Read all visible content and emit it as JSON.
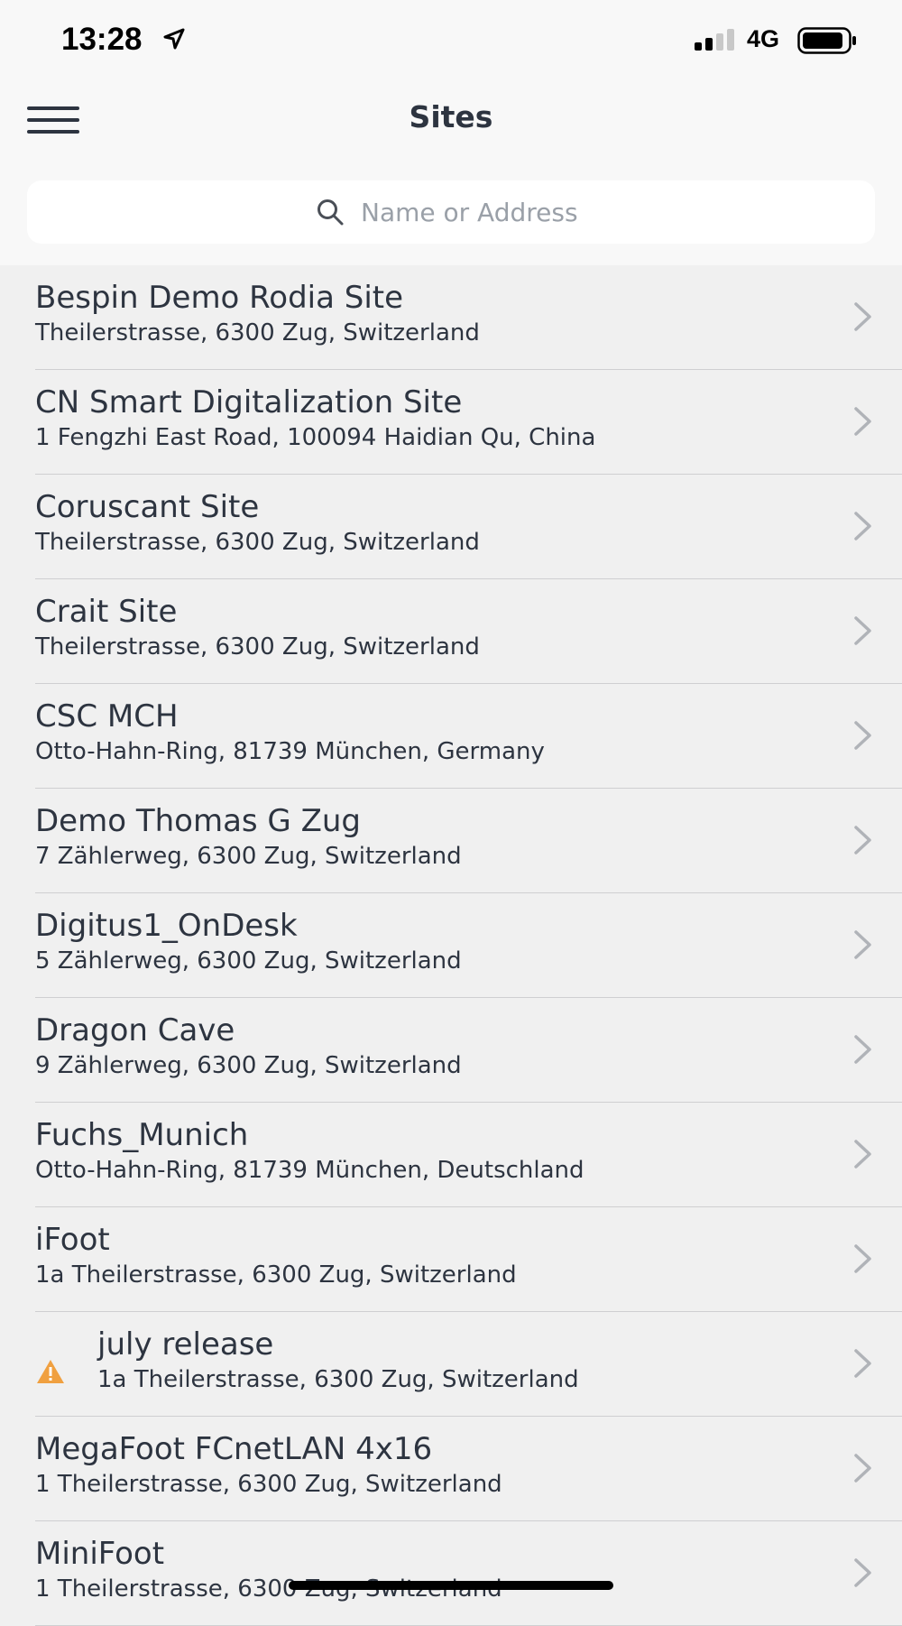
{
  "status_bar": {
    "time": "13:28",
    "network": "4G",
    "icons": [
      "location-arrow-icon",
      "signal-icon",
      "battery-icon"
    ]
  },
  "header": {
    "title": "Sites",
    "menu_icon": "hamburger-menu-icon"
  },
  "search": {
    "placeholder": "Name or Address",
    "value": "",
    "icon": "search-icon"
  },
  "colors": {
    "text": "#2d3440",
    "chevron": "#b0b3b8",
    "warning": "#f0a040",
    "background": "#f0f0f0",
    "header_bg": "#f8f8f8"
  },
  "sites": [
    {
      "name": "Bespin Demo Rodia Site",
      "address": "Theilerstrasse, 6300 Zug, Switzerland"
    },
    {
      "name": "CN Smart Digitalization Site",
      "address": "1 Fengzhi East Road, 100094 Haidian Qu, China"
    },
    {
      "name": "Coruscant Site",
      "address": "Theilerstrasse, 6300 Zug, Switzerland"
    },
    {
      "name": "Crait Site",
      "address": "Theilerstrasse, 6300 Zug, Switzerland"
    },
    {
      "name": "CSC MCH",
      "address": "Otto-Hahn-Ring, 81739 München, Germany"
    },
    {
      "name": "Demo Thomas G Zug",
      "address": "7 Zählerweg, 6300 Zug, Switzerland"
    },
    {
      "name": "Digitus1_OnDesk",
      "address": "5 Zählerweg, 6300 Zug, Switzerland"
    },
    {
      "name": "Dragon Cave",
      "address": "9 Zählerweg, 6300 Zug, Switzerland"
    },
    {
      "name": "Fuchs_Munich",
      "address": "Otto-Hahn-Ring, 81739 München, Deutschland"
    },
    {
      "name": "iFoot",
      "address": "1a Theilerstrasse, 6300 Zug, Switzerland"
    },
    {
      "name": "july release",
      "address": "1a Theilerstrasse, 6300 Zug, Switzerland",
      "warning": true
    },
    {
      "name": "MegaFoot FCnetLAN 4x16",
      "address": "1 Theilerstrasse, 6300 Zug, Switzerland"
    },
    {
      "name": "MiniFoot",
      "address": "1 Theilerstrasse, 6300 Zug, Switzerland"
    }
  ]
}
